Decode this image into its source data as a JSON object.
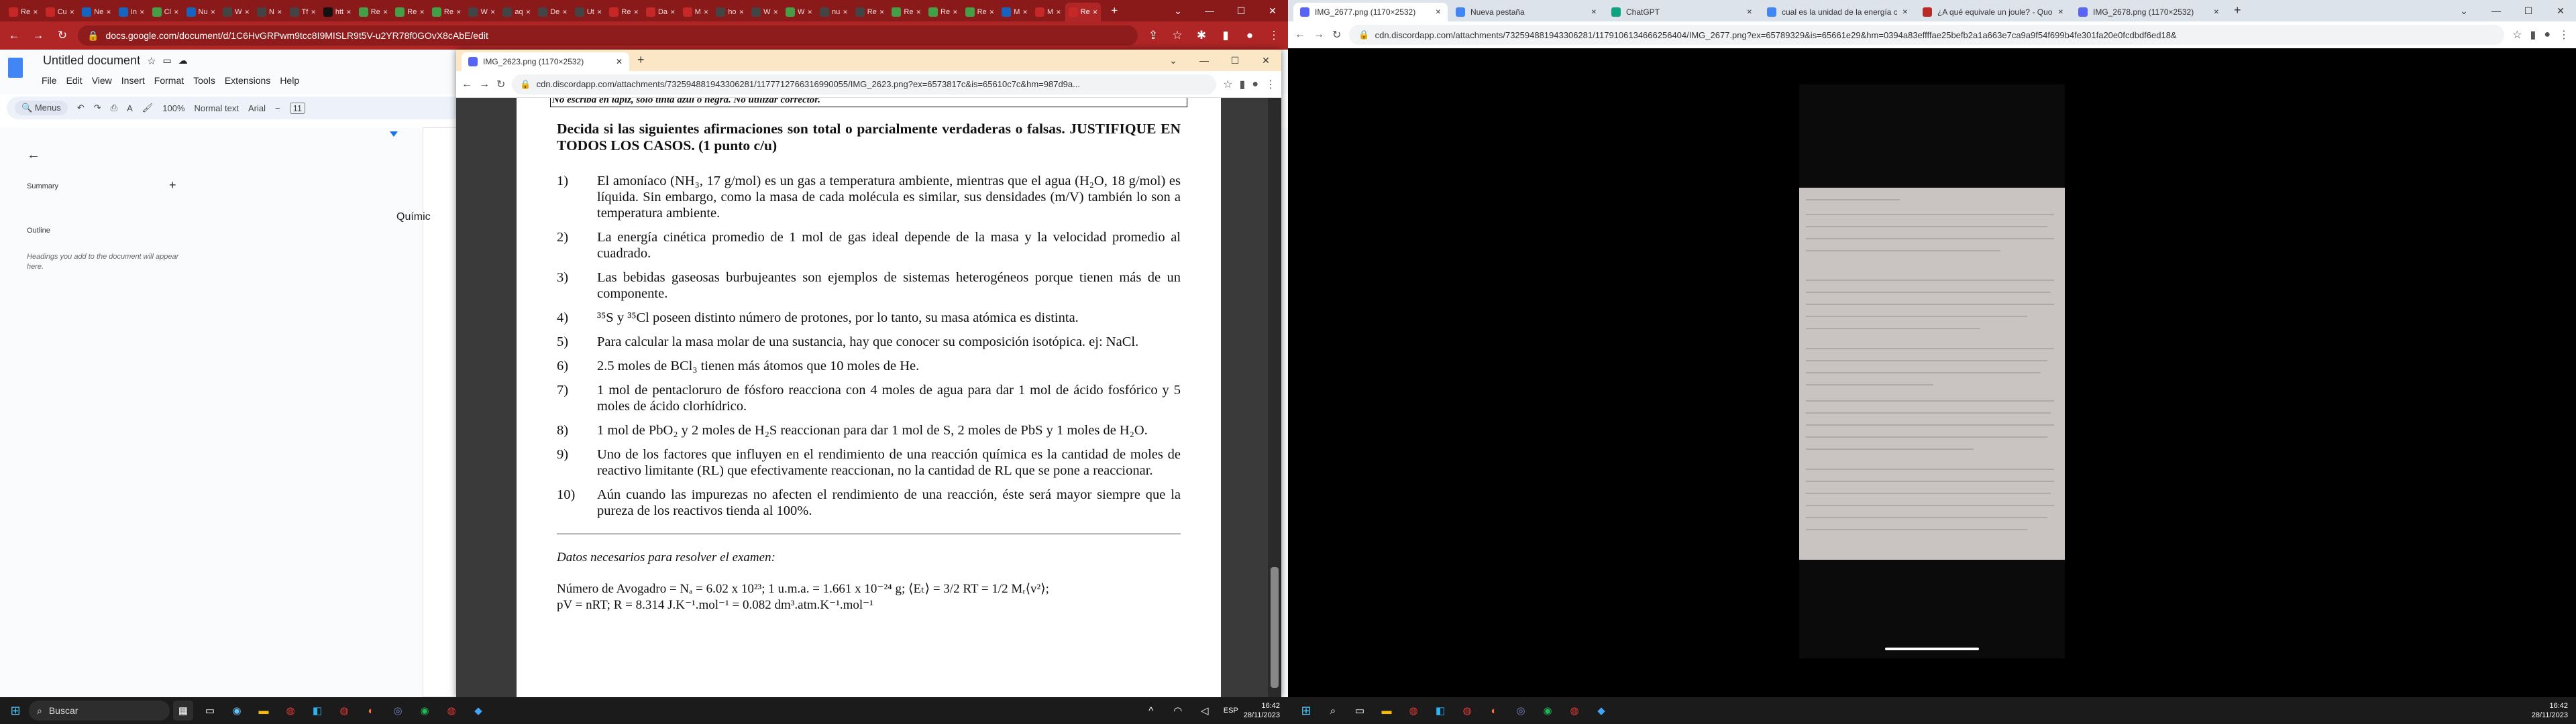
{
  "left_browser": {
    "tabs": [
      {
        "label": "Re",
        "color": "#c62828"
      },
      {
        "label": "Cu",
        "color": "#c62828"
      },
      {
        "label": "Ne",
        "color": "#1565c0"
      },
      {
        "label": "In",
        "color": "#1565c0"
      },
      {
        "label": "Cl",
        "color": "#43a047"
      },
      {
        "label": "Nu",
        "color": "#1565c0"
      },
      {
        "label": "W",
        "color": "#444"
      },
      {
        "label": "N",
        "color": "#444"
      },
      {
        "label": "Tf",
        "color": "#444"
      },
      {
        "label": "htt",
        "color": "#111"
      },
      {
        "label": "Re",
        "color": "#43a047"
      },
      {
        "label": "Re",
        "color": "#43a047"
      },
      {
        "label": "Re",
        "color": "#43a047"
      },
      {
        "label": "W",
        "color": "#444"
      },
      {
        "label": "aq",
        "color": "#444"
      },
      {
        "label": "De",
        "color": "#444"
      },
      {
        "label": "Ut",
        "color": "#444"
      },
      {
        "label": "Re",
        "color": "#c62828"
      },
      {
        "label": "Da",
        "color": "#c62828"
      },
      {
        "label": "M",
        "color": "#c62828"
      },
      {
        "label": "ho",
        "color": "#444"
      },
      {
        "label": "W",
        "color": "#444"
      },
      {
        "label": "W",
        "color": "#43a047"
      },
      {
        "label": "nu",
        "color": "#444"
      },
      {
        "label": "Re",
        "color": "#444"
      },
      {
        "label": "Re",
        "color": "#43a047"
      },
      {
        "label": "Re",
        "color": "#43a047"
      },
      {
        "label": "Re",
        "color": "#43a047"
      },
      {
        "label": "M",
        "color": "#1565c0"
      },
      {
        "label": "M",
        "color": "#c62828"
      },
      {
        "label": "Re",
        "color": "#c62828",
        "active": true
      }
    ],
    "url": "docs.google.com/document/d/1C6HvGRPwm9tcc8I9MISLR9t5V-u2YR78f0GOvX8cAbE/edit"
  },
  "docs": {
    "title": "Untitled document",
    "menu": [
      "File",
      "Edit",
      "View",
      "Insert",
      "Format",
      "Tools",
      "Extensions",
      "Help"
    ],
    "toolbar": {
      "menus": "Menus",
      "zoom": "100%",
      "style": "Normal text",
      "font": "Arial",
      "size": "11"
    },
    "summary": "Summary",
    "outline": "Outline",
    "outline_hint": "Headings you add to the document will appear here.",
    "page_text": "Químic"
  },
  "viewer": {
    "tab_title": "IMG_2623.png (1170×2532)",
    "url": "cdn.discordapp.com/attachments/732594881943306281/1177712766316990055/IMG_2623.png?ex=6573817c&is=65610c7c&hm=987d9a..."
  },
  "exam": {
    "top_line": "No escriba en lápiz, sólo tinta azul o negra. No utilizar corrector.",
    "heading": "Decida si las siguientes afirmaciones son total o parcialmente verdaderas o falsas. JUSTIFIQUE EN TODOS LOS CASOS. (1 punto c/u)",
    "questions": [
      {
        "n": "1)",
        "t": "El amoníaco (NH₃, 17 g/mol) es un gas a temperatura ambiente, mientras que el agua (H₂O, 18 g/mol) es líquida. Sin embargo, como la masa de cada molécula es similar, sus densidades (m/V) también lo son a temperatura ambiente."
      },
      {
        "n": "2)",
        "t": "La energía cinética promedio de 1 mol de gas ideal depende de la masa y la velocidad promedio al cuadrado."
      },
      {
        "n": "3)",
        "t": "Las bebidas gaseosas burbujeantes son ejemplos de sistemas heterogéneos porque tienen más de un componente."
      },
      {
        "n": "4)",
        "t": "³⁵S y ³⁵Cl poseen distinto número de protones, por lo tanto, su masa atómica es distinta."
      },
      {
        "n": "5)",
        "t": "Para calcular la masa molar de una sustancia, hay que conocer su composición isotópica. ej:  NaCl."
      },
      {
        "n": "6)",
        "t": "2.5 moles de BCl₃ tienen más átomos que 10 moles de He."
      },
      {
        "n": "7)",
        "t": "1 mol de pentacloruro de fósforo reacciona con 4 moles de agua para dar 1 mol de ácido fosfórico y 5 moles de ácido clorhídrico."
      },
      {
        "n": "8)",
        "t": "1 mol de PbO₂ y 2 moles de H₂S reaccionan para dar 1 mol de S, 2 moles de PbS y 1 moles de H₂O."
      },
      {
        "n": "9)",
        "t": "Uno de los factores que influyen en el rendimiento de una reacción química es la cantidad de moles de reactivo limitante (RL) que efectivamente reaccionan, no la cantidad de RL que se pone a reaccionar."
      },
      {
        "n": "10)",
        "t": "Aún cuando las impurezas no afecten el rendimiento de una reacción, éste será mayor siempre que la pureza de los reactivos tienda al 100%."
      }
    ],
    "data_title": "Datos necesarios para resolver el examen:",
    "data_line1": "Número de Avogadro = Nₐ = 6.02 x 10²³; 1 u.m.a. = 1.661 x 10⁻²⁴ g; ⟨Eₜ⟩ = 3/2 RT = 1/2 Mᵣ⟨v²⟩;",
    "data_line2": "pV = nRT; R = 8.314 J.K⁻¹.mol⁻¹ = 0.082 dm³.atm.K⁻¹.mol⁻¹"
  },
  "taskbar_left": {
    "search": "Buscar",
    "lang": "ESP",
    "time": "16:42",
    "date": "28/11/2023"
  },
  "right_browser": {
    "tabs": [
      {
        "label": "IMG_2677.png (1170×2532)",
        "active": true
      },
      {
        "label": "Nueva pestaña"
      },
      {
        "label": "ChatGPT"
      },
      {
        "label": "cual es la unidad de la energía cin"
      },
      {
        "label": "¿A qué equivale un joule? - Quora"
      },
      {
        "label": "IMG_2678.png (1170×2532)"
      }
    ],
    "url": "cdn.discordapp.com/attachments/732594881943306281/1179106134666256404/IMG_2677.png?ex=65789329&is=65661e29&hm=0394a83effffae25befb2a1a663e7ca9a9f54f699b4fe301fa20e0fcdbdf6ed18&"
  },
  "taskbar_right": {
    "time": "16:42",
    "date": "28/11/2023"
  }
}
